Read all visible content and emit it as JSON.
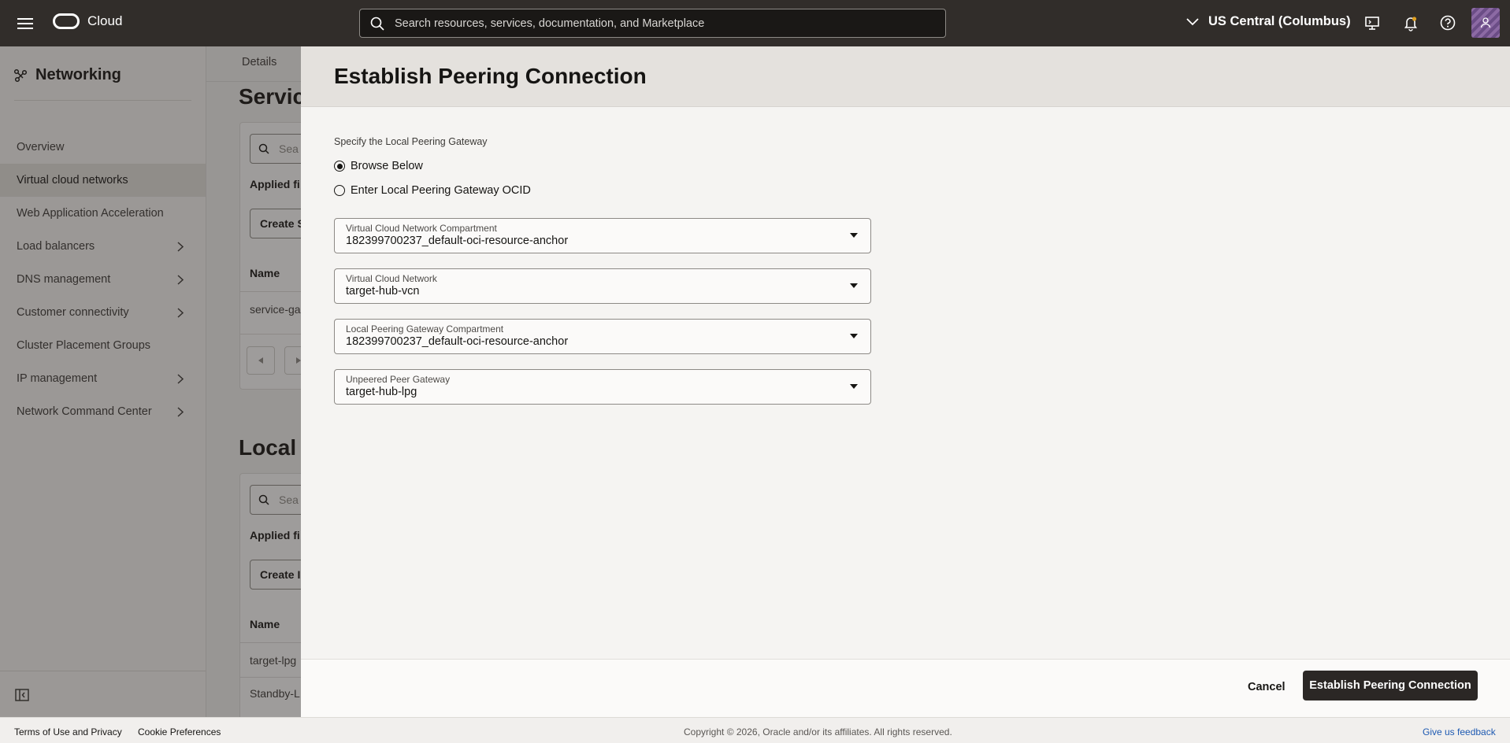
{
  "topbar": {
    "app_name": "Cloud",
    "search_placeholder": "Search resources, services, documentation, and Marketplace",
    "region": "US Central (Columbus)",
    "icons": [
      "hamburger-menu-icon",
      "oracle-logo",
      "search-icon",
      "chevron-down-icon",
      "cloud-shell-icon",
      "bell-icon",
      "help-icon",
      "user-icon"
    ]
  },
  "sidebar": {
    "title": "Networking",
    "items": [
      {
        "label": "Overview",
        "has_children": false,
        "active": false
      },
      {
        "label": "Virtual cloud networks",
        "has_children": false,
        "active": true
      },
      {
        "label": "Web Application Acceleration",
        "has_children": false,
        "active": false
      },
      {
        "label": "Load balancers",
        "has_children": true,
        "active": false
      },
      {
        "label": "DNS management",
        "has_children": true,
        "active": false
      },
      {
        "label": "Customer connectivity",
        "has_children": true,
        "active": false
      },
      {
        "label": "Cluster Placement Groups",
        "has_children": false,
        "active": false
      },
      {
        "label": "IP management",
        "has_children": true,
        "active": false
      },
      {
        "label": "Network Command Center",
        "has_children": true,
        "active": false
      }
    ]
  },
  "background": {
    "tab": "Details",
    "section1": {
      "heading": "Servic",
      "search": "Sea",
      "applied": "Applied fi",
      "create": "Create S",
      "col_name": "Name",
      "row1": "service-ga"
    },
    "section2": {
      "heading": "Local",
      "search": "Sea",
      "applied": "Applied fi",
      "create": "Create I",
      "col_name": "Name",
      "row1": "target-lpg",
      "row2": "Standby-L"
    }
  },
  "drawer": {
    "title": "Establish Peering Connection",
    "section_label": "Specify the Local Peering Gateway",
    "radios": [
      {
        "label": "Browse Below",
        "checked": true
      },
      {
        "label": "Enter Local Peering Gateway OCID",
        "checked": false
      }
    ],
    "selects": [
      {
        "label": "Virtual Cloud Network Compartment",
        "value": "182399700237_default-oci-resource-anchor"
      },
      {
        "label": "Virtual Cloud Network",
        "value": "target-hub-vcn"
      },
      {
        "label": "Local Peering Gateway Compartment",
        "value": "182399700237_default-oci-resource-anchor"
      },
      {
        "label": "Unpeered Peer Gateway",
        "value": "target-hub-lpg"
      }
    ],
    "cancel": "Cancel",
    "submit": "Establish Peering Connection"
  },
  "footer": {
    "terms": "Terms of Use and Privacy",
    "cookies": "Cookie Preferences",
    "copyright": "Copyright © 2026, Oracle and/or its affiliates. All rights reserved.",
    "feedback": "Give us feedback"
  }
}
